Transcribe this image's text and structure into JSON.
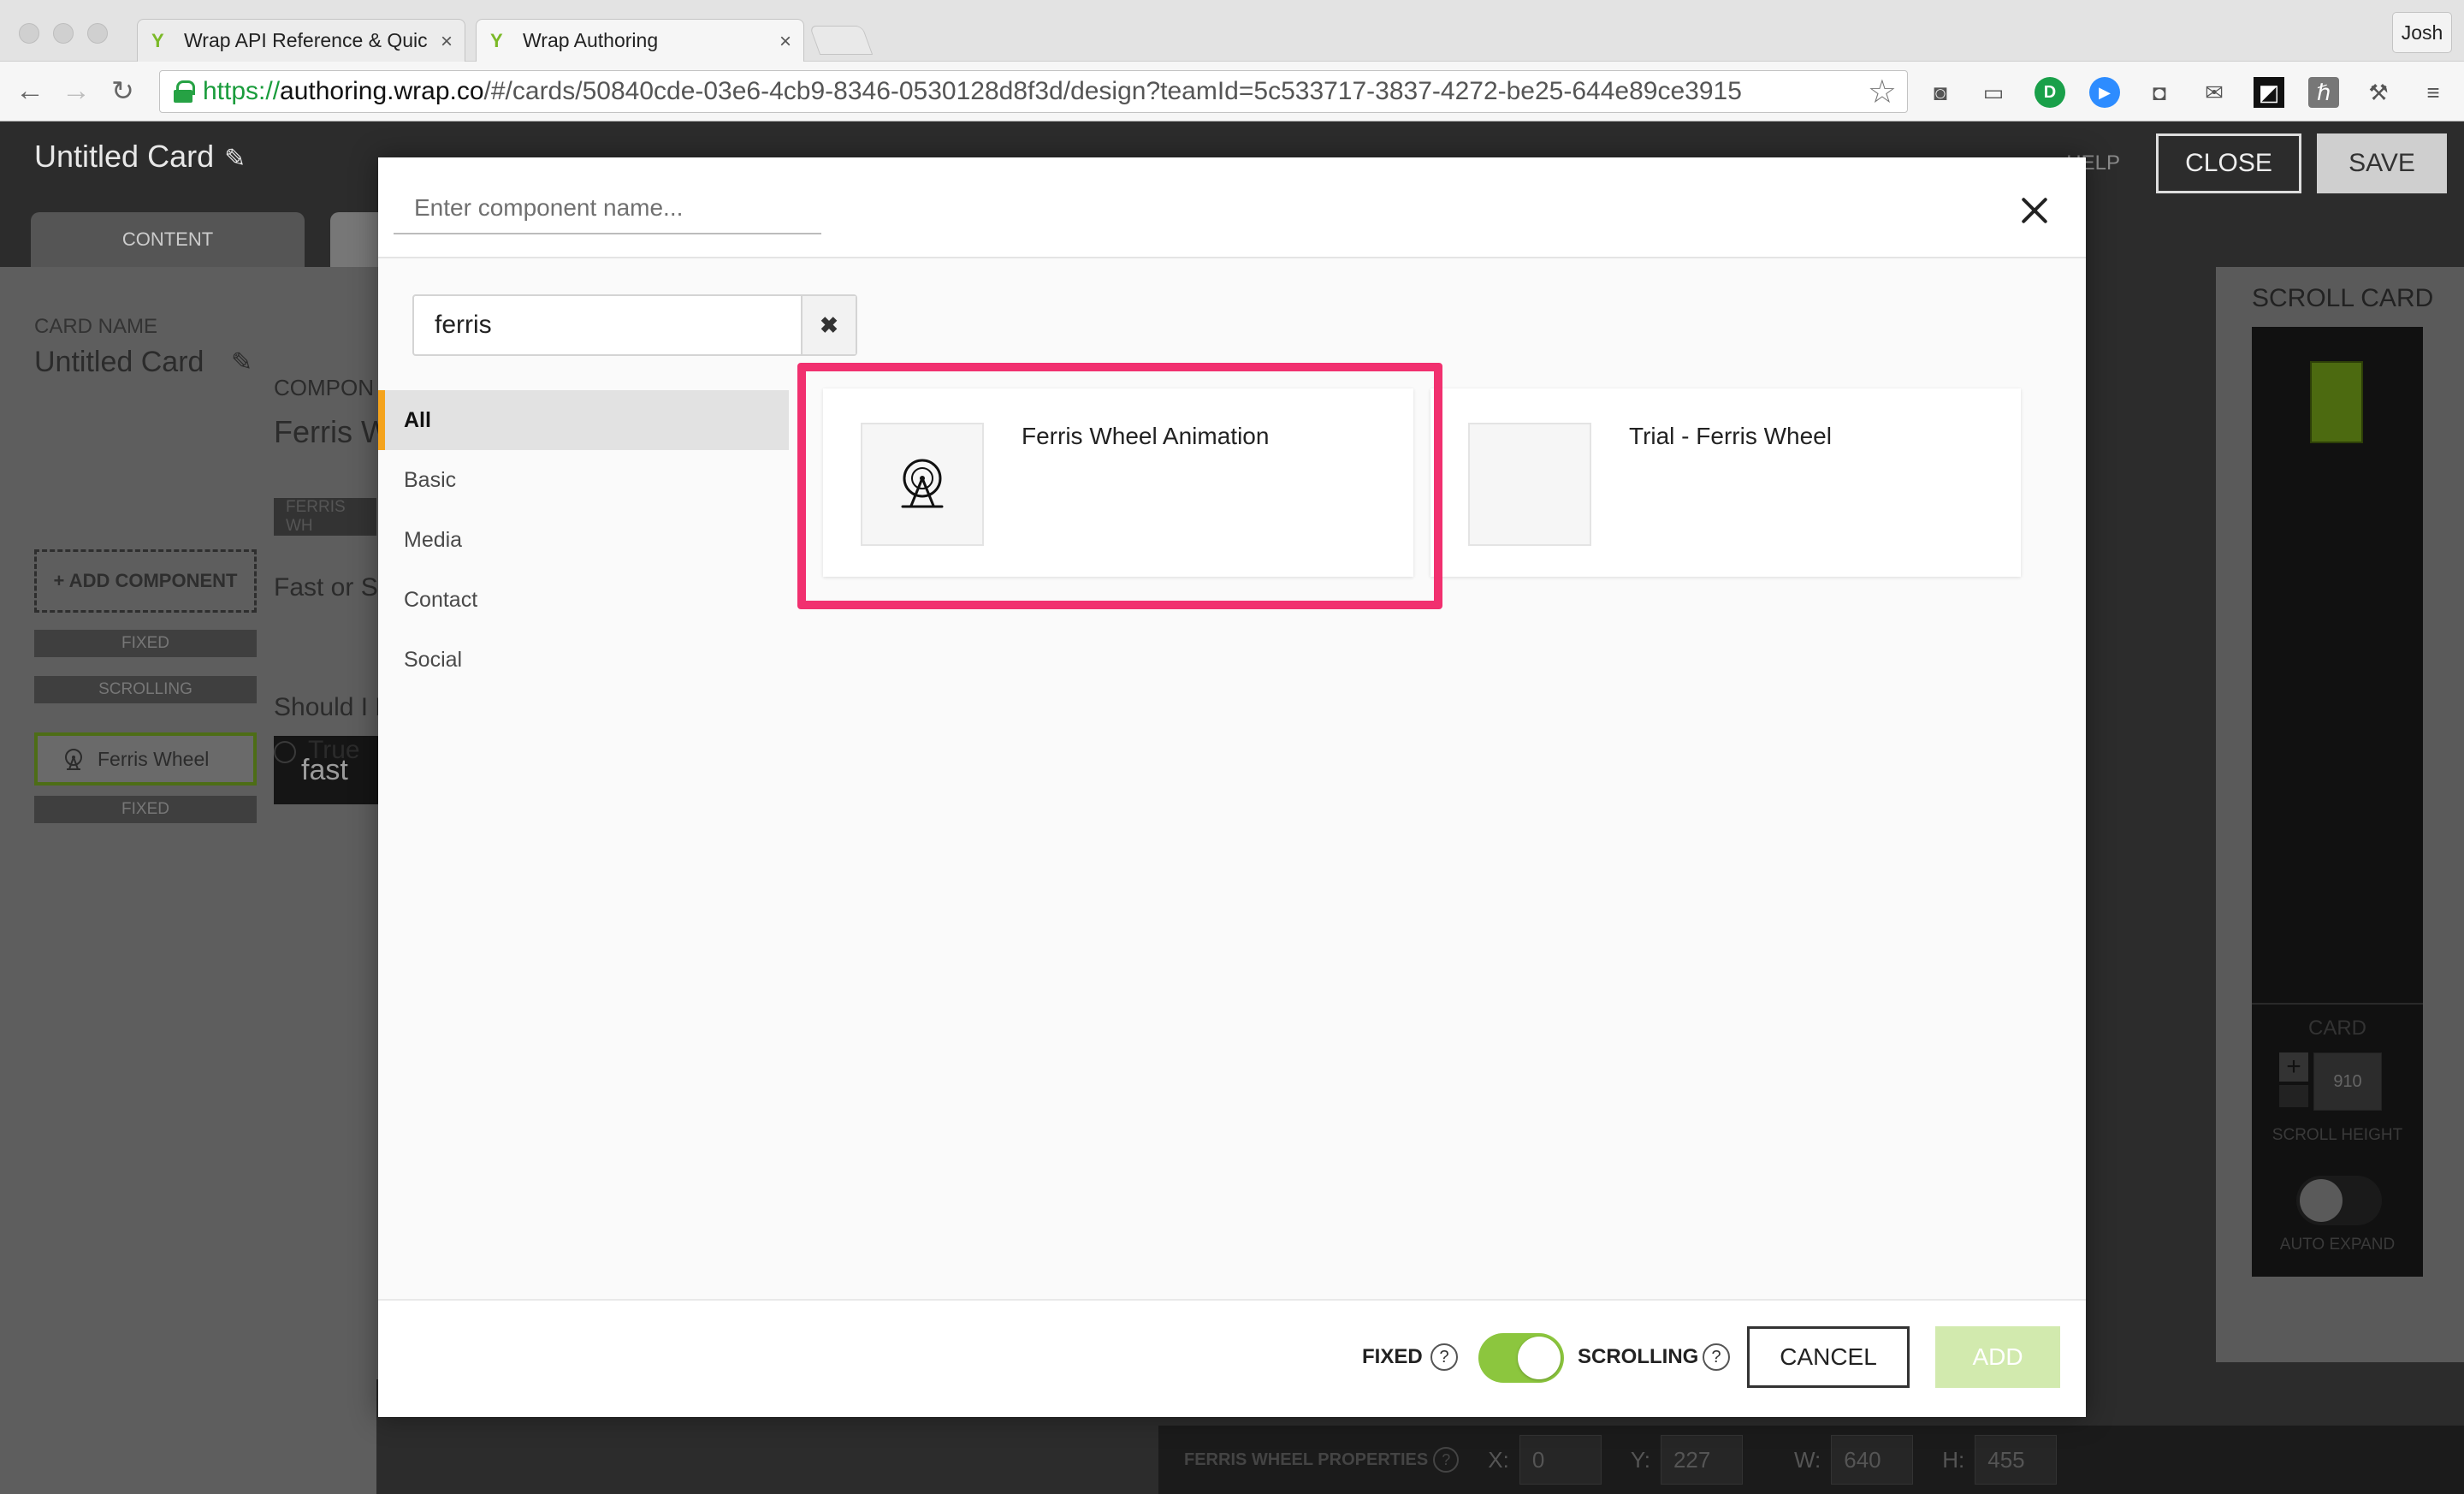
{
  "browser": {
    "tabs": [
      {
        "title": "Wrap API Reference & Quic",
        "active": false
      },
      {
        "title": "Wrap Authoring",
        "active": true
      }
    ],
    "profile": "Josh",
    "url": {
      "scheme": "https://",
      "host": "authoring.wrap.co",
      "path": "/#/cards/50840cde-03e6-4cb9-8346-0530128d8f3d/design?teamId=5c533717-3837-4272-be25-644e89ce3915"
    },
    "extensions": [
      "camera-icon",
      "cast-icon",
      "grammarly-icon",
      "zoom-icon",
      "screenshot-icon",
      "mail-icon",
      "crop-icon",
      "hashtag-icon",
      "tool-icon",
      "menu-icon"
    ]
  },
  "app": {
    "title": "Untitled Card",
    "help": "HELP",
    "close": "CLOSE",
    "save": "SAVE",
    "content_tab": "CONTENT",
    "card_name_label": "CARD NAME",
    "card_name": "Untitled Card",
    "add_component": "+ ADD COMPONENT",
    "fixed_top": "FIXED",
    "scrolling": "SCROLLING",
    "layer_item": "Ferris Wheel",
    "fixed_bottom": "FIXED",
    "component_label": "COMPON",
    "component_name": "Ferris W",
    "property_header": "FERRIS WH",
    "question1": "Fast or Sl",
    "fast_value": "fast",
    "question2": "Should I E",
    "radio_true": "True",
    "scroll_card": "SCROLL CARD",
    "card_label": "CARD",
    "scroll_height_value": "910",
    "scroll_height_label": "SCROLL HEIGHT",
    "auto_expand": "AUTO EXPAND",
    "properties": {
      "title": "FERRIS WHEEL PROPERTIES",
      "x_label": "X:",
      "x": "0",
      "y_label": "Y:",
      "y": "227",
      "w_label": "W:",
      "w": "640",
      "h_label": "H:",
      "h": "455"
    }
  },
  "modal": {
    "name_placeholder": "Enter component name...",
    "search_value": "ferris",
    "categories": [
      "All",
      "Basic",
      "Media",
      "Contact",
      "Social"
    ],
    "active_category": "All",
    "results": [
      {
        "title": "Ferris Wheel Animation",
        "icon": "ferris-wheel-icon",
        "highlighted": true
      },
      {
        "title": "Trial - Ferris Wheel",
        "icon": "",
        "highlighted": false
      }
    ],
    "footer": {
      "fixed": "FIXED",
      "scrolling": "SCROLLING",
      "toggle_on": true,
      "cancel": "CANCEL",
      "add": "ADD"
    },
    "colors": {
      "highlight": "#f1306f",
      "accent_toggle": "#8cc63e",
      "active_category_marker": "#f4a31d",
      "add_disabled": "#d2eaae"
    }
  }
}
